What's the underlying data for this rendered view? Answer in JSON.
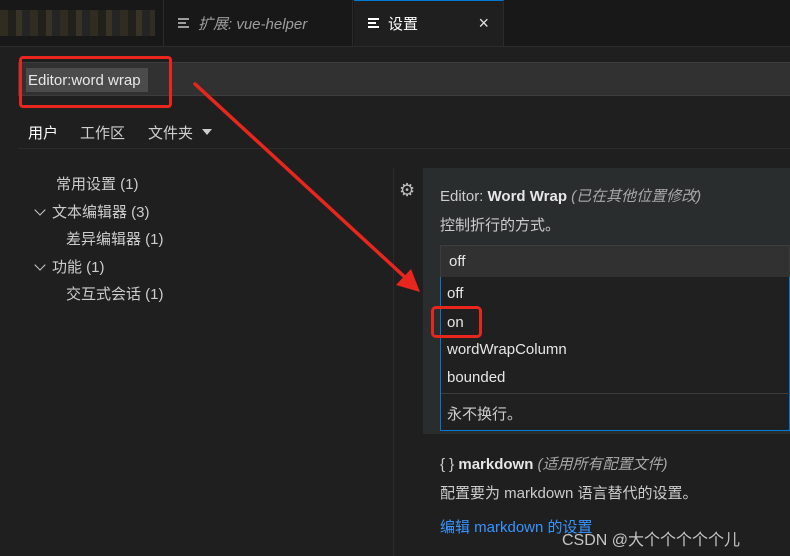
{
  "tabs": {
    "extension": {
      "label": "扩展: vue-helper",
      "icon": "preview-icon"
    },
    "settings": {
      "label": "设置",
      "icon": "settings-doc-icon",
      "close": "×"
    }
  },
  "search": {
    "value": "Editor:word wrap"
  },
  "scope_tabs": [
    {
      "label": "用户",
      "active": true
    },
    {
      "label": "工作区"
    },
    {
      "label": "文件夹"
    }
  ],
  "toc": [
    {
      "label": "常用设置 (1)"
    },
    {
      "label": "文本编辑器 (3)",
      "expanded": true
    },
    {
      "label": "差异编辑器 (1)"
    },
    {
      "label": "功能 (1)",
      "expanded": true
    },
    {
      "label": "交互式会话 (1)"
    }
  ],
  "word_wrap": {
    "category": "Editor: ",
    "name": "Word Wrap",
    "note": "(已在其他位置修改)",
    "description": "控制折行的方式。",
    "current": "off",
    "options": [
      "off",
      "on",
      "wordWrapColumn",
      "bounded"
    ],
    "option_description": "永不换行。"
  },
  "markdown": {
    "braces": "{ }",
    "name": "markdown",
    "note": "(适用所有配置文件)",
    "description": "配置要为 markdown 语言替代的设置。",
    "link": "编辑 markdown 的设置"
  },
  "watermark": "CSDN @大个个个个个儿",
  "colors": {
    "annotation_red": "#e8261e",
    "accent_blue": "#0078d4",
    "link_blue": "#3794ff"
  }
}
